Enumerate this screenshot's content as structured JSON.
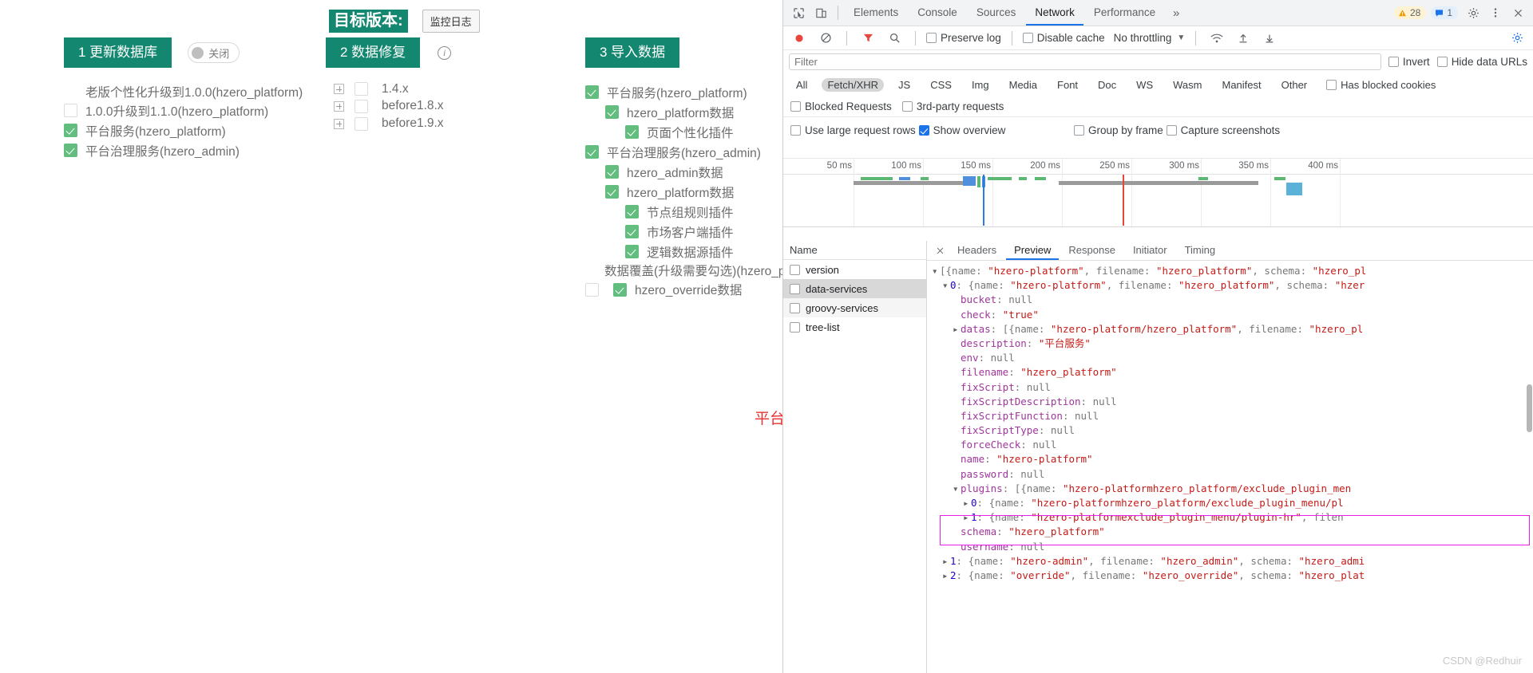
{
  "app": {
    "step1": {
      "button": "1 更新数据库",
      "toggle": "关闭",
      "items": [
        {
          "label": "老版个性化升级到1.0.0(hzero_platform)",
          "checked": false,
          "showbox": false
        },
        {
          "label": "1.0.0升级到1.1.0(hzero_platform)",
          "checked": false,
          "showbox": true
        },
        {
          "label": "平台服务(hzero_platform)",
          "checked": true,
          "showbox": true
        },
        {
          "label": "平台治理服务(hzero_admin)",
          "checked": true,
          "showbox": true
        }
      ]
    },
    "target_version": {
      "label": "目标版本:",
      "monitor_button": "监控日志"
    },
    "step2": {
      "button": "2 数据修复",
      "info_icon": "info-icon",
      "items": [
        {
          "label": "1.4.x",
          "checked": false
        },
        {
          "label": "before1.8.x",
          "checked": false
        },
        {
          "label": "before1.9.x",
          "checked": false
        }
      ]
    },
    "step3": {
      "button": "3 导入数据",
      "tree": [
        {
          "label": "平台服务(hzero_platform)",
          "depth": 0,
          "checked": true
        },
        {
          "label": "hzero_platform数据",
          "depth": 1,
          "checked": true
        },
        {
          "label": "页面个性化插件",
          "depth": 2,
          "checked": true
        },
        {
          "label": "平台治理服务(hzero_admin)",
          "depth": 0,
          "checked": true
        },
        {
          "label": "hzero_admin数据",
          "depth": 1,
          "checked": true
        },
        {
          "label": "hzero_platform数据",
          "depth": 1,
          "checked": true
        },
        {
          "label": "节点组规则插件",
          "depth": 2,
          "checked": true
        },
        {
          "label": "市场客户端插件",
          "depth": 2,
          "checked": true
        },
        {
          "label": "逻辑数据源插件",
          "depth": 2,
          "checked": true
        }
      ],
      "override_label": "数据覆盖(升级需要勾选)(hzero_plat",
      "override_item": {
        "label": "hzero_override数据",
        "checked": true
      }
    },
    "annotation": "平台服务中有两个插件"
  },
  "devtools": {
    "tabs": [
      "Elements",
      "Console",
      "Sources",
      "Network",
      "Performance"
    ],
    "active_tab": "Network",
    "more_tabs_icon": "chevron-double-right-icon",
    "warning_count": "28",
    "message_count": "1",
    "settings_icon": "gear-icon",
    "menu_icon": "kebab-menu-icon",
    "close_icon": "close-icon",
    "inspect_icon": "inspect-element-icon",
    "device_icon": "device-toolbar-icon",
    "record_icon": "record-circle-icon",
    "clear_icon": "clear-no-entry-icon",
    "filter_icon": "funnel-filter-icon",
    "search_icon": "search-magnifier-icon",
    "import_icon": "import-har-icon",
    "export_icon": "export-har-icon",
    "wifi_icon": "network-conditions-icon",
    "settings_gear_blue_icon": "network-settings-gear-icon",
    "toolbar": {
      "preserve_log": "Preserve log",
      "preserve_log_checked": false,
      "disable_cache": "Disable cache",
      "disable_cache_checked": false,
      "throttling": "No throttling",
      "throttling_caret": "chevron-down-icon"
    },
    "filter": {
      "placeholder": "Filter",
      "value": "",
      "invert": "Invert",
      "invert_checked": false,
      "hide_data_urls": "Hide data URLs",
      "hide_data_urls_checked": false
    },
    "resource_types": [
      "All",
      "Fetch/XHR",
      "JS",
      "CSS",
      "Img",
      "Media",
      "Font",
      "Doc",
      "WS",
      "Wasm",
      "Manifest",
      "Other"
    ],
    "selected_resource_type": "Fetch/XHR",
    "has_blocked_cookies": "Has blocked cookies",
    "has_blocked_cookies_checked": false,
    "blocked_requests": "Blocked Requests",
    "blocked_requests_checked": false,
    "third_party": "3rd-party requests",
    "third_party_checked": false,
    "options": {
      "use_large_rows": "Use large request rows",
      "use_large_rows_checked": false,
      "group_by_frame": "Group by frame",
      "group_by_frame_checked": false,
      "show_overview": "Show overview",
      "show_overview_checked": true,
      "capture_screenshots": "Capture screenshots",
      "capture_screenshots_checked": false
    },
    "overview_ticks": [
      "50 ms",
      "100 ms",
      "150 ms",
      "200 ms",
      "250 ms",
      "300 ms",
      "350 ms",
      "400 ms"
    ],
    "name_column_header": "Name",
    "requests": [
      {
        "name": "version",
        "selected": false
      },
      {
        "name": "data-services",
        "selected": true
      },
      {
        "name": "groovy-services",
        "selected": false
      },
      {
        "name": "tree-list",
        "selected": false
      }
    ],
    "detail_tabs": [
      "Headers",
      "Preview",
      "Response",
      "Initiator",
      "Timing"
    ],
    "detail_active_tab": "Preview",
    "preview_lines": [
      {
        "indent": 0,
        "tri": "down",
        "parts": [
          {
            "t": "[{name: ",
            "c": "n"
          },
          {
            "t": "\"hzero-platform\"",
            "c": "s"
          },
          {
            "t": ", filename: ",
            "c": "n"
          },
          {
            "t": "\"hzero_platform\"",
            "c": "s"
          },
          {
            "t": ", schema: ",
            "c": "n"
          },
          {
            "t": "\"hzero_pl",
            "c": "s"
          }
        ]
      },
      {
        "indent": 1,
        "tri": "down",
        "parts": [
          {
            "t": "0",
            "c": "num"
          },
          {
            "t": ": {name: ",
            "c": "n"
          },
          {
            "t": "\"hzero-platform\"",
            "c": "s"
          },
          {
            "t": ", filename: ",
            "c": "n"
          },
          {
            "t": "\"hzero_platform\"",
            "c": "s"
          },
          {
            "t": ", schema: ",
            "c": "n"
          },
          {
            "t": "\"hzer",
            "c": "s"
          }
        ]
      },
      {
        "indent": 2,
        "tri": "none",
        "parts": [
          {
            "t": "bucket",
            "c": "k"
          },
          {
            "t": ": ",
            "c": "n"
          },
          {
            "t": "null",
            "c": "n"
          }
        ]
      },
      {
        "indent": 2,
        "tri": "none",
        "parts": [
          {
            "t": "check",
            "c": "k"
          },
          {
            "t": ": ",
            "c": "n"
          },
          {
            "t": "\"true\"",
            "c": "s"
          }
        ]
      },
      {
        "indent": 2,
        "tri": "right",
        "parts": [
          {
            "t": "datas",
            "c": "k"
          },
          {
            "t": ": [{name: ",
            "c": "n"
          },
          {
            "t": "\"hzero-platform/hzero_platform\"",
            "c": "s"
          },
          {
            "t": ", filename: ",
            "c": "n"
          },
          {
            "t": "\"hzero_pl",
            "c": "s"
          }
        ]
      },
      {
        "indent": 2,
        "tri": "none",
        "parts": [
          {
            "t": "description",
            "c": "k"
          },
          {
            "t": ": ",
            "c": "n"
          },
          {
            "t": "\"平台服务\"",
            "c": "s"
          }
        ]
      },
      {
        "indent": 2,
        "tri": "none",
        "parts": [
          {
            "t": "env",
            "c": "k"
          },
          {
            "t": ": ",
            "c": "n"
          },
          {
            "t": "null",
            "c": "n"
          }
        ]
      },
      {
        "indent": 2,
        "tri": "none",
        "parts": [
          {
            "t": "filename",
            "c": "k"
          },
          {
            "t": ": ",
            "c": "n"
          },
          {
            "t": "\"hzero_platform\"",
            "c": "s"
          }
        ]
      },
      {
        "indent": 2,
        "tri": "none",
        "parts": [
          {
            "t": "fixScript",
            "c": "k"
          },
          {
            "t": ": ",
            "c": "n"
          },
          {
            "t": "null",
            "c": "n"
          }
        ]
      },
      {
        "indent": 2,
        "tri": "none",
        "parts": [
          {
            "t": "fixScriptDescription",
            "c": "k"
          },
          {
            "t": ": ",
            "c": "n"
          },
          {
            "t": "null",
            "c": "n"
          }
        ]
      },
      {
        "indent": 2,
        "tri": "none",
        "parts": [
          {
            "t": "fixScriptFunction",
            "c": "k"
          },
          {
            "t": ": ",
            "c": "n"
          },
          {
            "t": "null",
            "c": "n"
          }
        ]
      },
      {
        "indent": 2,
        "tri": "none",
        "parts": [
          {
            "t": "fixScriptType",
            "c": "k"
          },
          {
            "t": ": ",
            "c": "n"
          },
          {
            "t": "null",
            "c": "n"
          }
        ]
      },
      {
        "indent": 2,
        "tri": "none",
        "parts": [
          {
            "t": "forceCheck",
            "c": "k"
          },
          {
            "t": ": ",
            "c": "n"
          },
          {
            "t": "null",
            "c": "n"
          }
        ]
      },
      {
        "indent": 2,
        "tri": "none",
        "parts": [
          {
            "t": "name",
            "c": "k"
          },
          {
            "t": ": ",
            "c": "n"
          },
          {
            "t": "\"hzero-platform\"",
            "c": "s"
          }
        ]
      },
      {
        "indent": 2,
        "tri": "none",
        "parts": [
          {
            "t": "password",
            "c": "k"
          },
          {
            "t": ": ",
            "c": "n"
          },
          {
            "t": "null",
            "c": "n"
          }
        ]
      },
      {
        "indent": 2,
        "tri": "down",
        "parts": [
          {
            "t": "plugins",
            "c": "k"
          },
          {
            "t": ": [{name: ",
            "c": "n"
          },
          {
            "t": "\"hzero-platformhzero_platform/exclude_plugin_men",
            "c": "s"
          }
        ]
      },
      {
        "indent": 3,
        "tri": "right",
        "parts": [
          {
            "t": "0",
            "c": "num"
          },
          {
            "t": ": {name: ",
            "c": "n"
          },
          {
            "t": "\"hzero-platformhzero_platform/exclude_plugin_menu/pl",
            "c": "s"
          }
        ]
      },
      {
        "indent": 3,
        "tri": "right",
        "parts": [
          {
            "t": "1",
            "c": "num"
          },
          {
            "t": ": {name: ",
            "c": "n"
          },
          {
            "t": "\"hzero-platformexclude_plugin_menu/plugin-hr\"",
            "c": "s"
          },
          {
            "t": ", filen",
            "c": "n"
          }
        ]
      },
      {
        "indent": 2,
        "tri": "none",
        "parts": [
          {
            "t": "schema",
            "c": "k"
          },
          {
            "t": ": ",
            "c": "n"
          },
          {
            "t": "\"hzero_platform\"",
            "c": "s"
          }
        ]
      },
      {
        "indent": 2,
        "tri": "none",
        "parts": [
          {
            "t": "username",
            "c": "k"
          },
          {
            "t": ": ",
            "c": "n"
          },
          {
            "t": "null",
            "c": "n"
          }
        ]
      },
      {
        "indent": 1,
        "tri": "right",
        "parts": [
          {
            "t": "1",
            "c": "num"
          },
          {
            "t": ": {name: ",
            "c": "n"
          },
          {
            "t": "\"hzero-admin\"",
            "c": "s"
          },
          {
            "t": ", filename: ",
            "c": "n"
          },
          {
            "t": "\"hzero_admin\"",
            "c": "s"
          },
          {
            "t": ", schema: ",
            "c": "n"
          },
          {
            "t": "\"hzero_admi",
            "c": "s"
          }
        ]
      },
      {
        "indent": 1,
        "tri": "right",
        "parts": [
          {
            "t": "2",
            "c": "num"
          },
          {
            "t": ": {name: ",
            "c": "n"
          },
          {
            "t": "\"override\"",
            "c": "s"
          },
          {
            "t": ", filename: ",
            "c": "n"
          },
          {
            "t": "\"hzero_override\"",
            "c": "s"
          },
          {
            "t": ", schema: ",
            "c": "n"
          },
          {
            "t": "\"hzero_plat",
            "c": "s"
          }
        ]
      }
    ]
  },
  "watermark": "CSDN @Redhuir"
}
